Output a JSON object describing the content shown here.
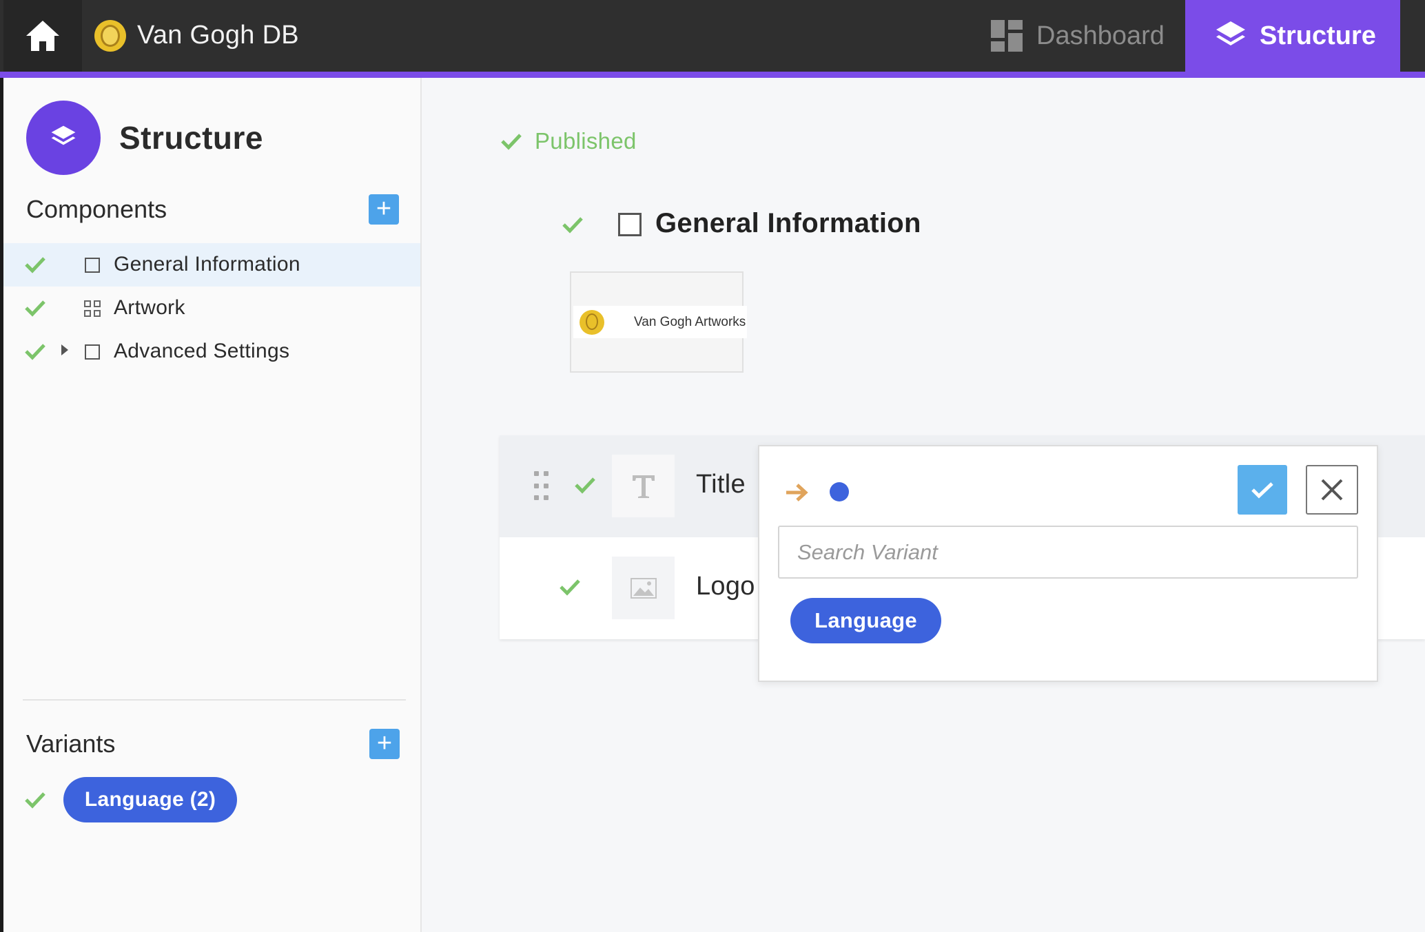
{
  "topbar": {
    "app_title": "Van Gogh DB",
    "nav": {
      "dashboard_label": "Dashboard",
      "structure_label": "Structure"
    }
  },
  "sidebar": {
    "title": "Structure",
    "components_heading": "Components",
    "components": [
      {
        "label": "General Information",
        "icon": "square-icon",
        "active": true,
        "status": "published"
      },
      {
        "label": "Artwork",
        "icon": "grid-icon",
        "active": false,
        "status": "published"
      },
      {
        "label": "Advanced Settings",
        "icon": "square-icon",
        "active": false,
        "status": "published",
        "expandable": true
      }
    ],
    "variants_heading": "Variants",
    "variants": [
      {
        "label": "Language (2)",
        "status": "published"
      }
    ]
  },
  "main": {
    "status_text": "Published",
    "component_title": "General Information",
    "preview_text": "Van Gogh Artworks",
    "fields": [
      {
        "label": "Title",
        "icon": "text-icon"
      },
      {
        "label": "Logo",
        "icon": "image-icon"
      }
    ]
  },
  "popover": {
    "search_placeholder": "Search Variant",
    "variant_option": "Language"
  },
  "colors": {
    "accent": "#7b4ce8",
    "topbar": "#2f2f2f",
    "pill_blue": "#3d63dd",
    "check_green": "#7cc46a",
    "button_blue": "#4da3ea"
  }
}
